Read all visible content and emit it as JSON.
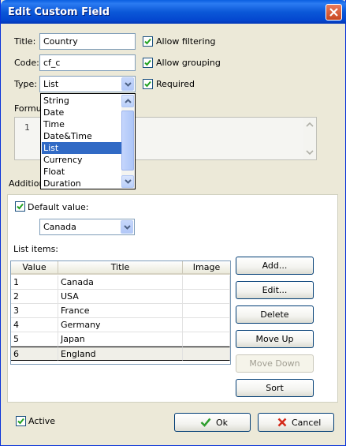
{
  "window": {
    "title": "Edit Custom Field"
  },
  "fields": {
    "title_label": "Title:",
    "title_value": "Country",
    "code_label": "Code:",
    "code_value": "cf_c",
    "type_label": "Type:",
    "type_value": "List",
    "formula_label": "Formul",
    "formula_line_number": "1",
    "additional_label": "Addition"
  },
  "options": {
    "allow_filtering": {
      "label": "Allow filtering",
      "checked": true
    },
    "allow_grouping": {
      "label": "Allow grouping",
      "checked": true
    },
    "required": {
      "label": "Required",
      "checked": true
    }
  },
  "type_dropdown": {
    "items": [
      "String",
      "Date",
      "Time",
      "Date&Time",
      "List",
      "Currency",
      "Float",
      "Duration"
    ],
    "selected": "List"
  },
  "additional": {
    "default_value_label": "Default value:",
    "default_value_checked": true,
    "default_value": "Canada",
    "list_items_label": "List items:"
  },
  "list_table": {
    "columns": [
      "Value",
      "Title",
      "Image"
    ],
    "rows": [
      {
        "value": "1",
        "title": "Canada",
        "image": ""
      },
      {
        "value": "2",
        "title": "USA",
        "image": ""
      },
      {
        "value": "3",
        "title": "France",
        "image": ""
      },
      {
        "value": "4",
        "title": "Germany",
        "image": ""
      },
      {
        "value": "5",
        "title": "Japan",
        "image": ""
      },
      {
        "value": "6",
        "title": "England",
        "image": ""
      }
    ],
    "selected_row": "6"
  },
  "buttons": {
    "add": "Add...",
    "edit": "Edit...",
    "delete": "Delete",
    "move_up": "Move Up",
    "move_down": "Move Down",
    "sort": "Sort",
    "ok": "Ok",
    "cancel": "Cancel"
  },
  "footer": {
    "active_label": "Active",
    "active_checked": true
  },
  "icons": {
    "check": "check-icon",
    "cancel": "red-x-icon",
    "close": "close-icon"
  },
  "colors": {
    "titlebar": "#0a5fe0",
    "selection": "#316ac5",
    "ok_icon": "#2e9e2e",
    "cancel_icon": "#d42a1a"
  }
}
